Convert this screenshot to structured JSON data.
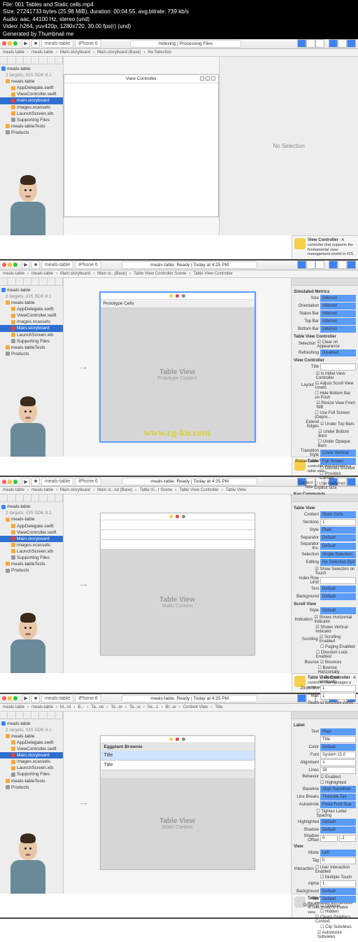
{
  "video_info": {
    "file": "File: 001 Tables and Static cells.mp4",
    "size": "Size: 27241733 bytes (25.98 MiB), duration: 00:04:55, avg.bitrate: 739 kb/s",
    "audio": "Audio: aac, 44100 Hz, stereo (und)",
    "video": "Video: h264, yuv420p, 1280x720, 30.00 fps(r) (und)",
    "gen": "Generated by Thumbnail me"
  },
  "watermark": "www.cg-ku.com",
  "nav": {
    "project": "meals-table",
    "targets": "2 targets, iOS SDK 8.1",
    "items": [
      "AppDelegate.swift",
      "ViewController.swift",
      "main.storyboard",
      "images.xcassets",
      "LaunchScreen.xib",
      "Supporting Files",
      "Main.storyboard",
      "meals-tableTests",
      "Products"
    ]
  },
  "status1": "Indexing | Processing Files",
  "status2": "meals-table: Ready | Today at 4:25 PM",
  "scheme": "meals-table",
  "device": "iPhone 6",
  "bc1": [
    "meals-table",
    "meals-table",
    "Main.storyboard",
    "Main.storyboard (Base)",
    "No Selection"
  ],
  "bc2": [
    "meals-table",
    "meals-table",
    "Main.storyboard",
    "Main st...(Base)",
    "Table View Controller Scene",
    "Table View Controller"
  ],
  "bc3": [
    "meals-table",
    "meals-table",
    "Main.storyboard",
    "Main st...nd (Base)",
    "Table Vi...r Scene",
    "Table View Controller",
    "Table View"
  ],
  "bc4": [
    "meals-table",
    "meals-table",
    "M...rd",
    "B...",
    "Ta...ne",
    "Ta...er",
    "Ta...w",
    "Se...1",
    "Br...ie",
    "Content View",
    "Title"
  ],
  "scene1": {
    "title": "View Controller"
  },
  "scene2": {
    "proto": "Prototype Cells",
    "tv": "Table View",
    "sub": "Prototype Content"
  },
  "scene3": {
    "tv": "Table View",
    "sub": "Static Content"
  },
  "scene4": {
    "header": "Eggplant Brownie",
    "cell1": "Title",
    "cell2": "Title",
    "tv": "Table View",
    "sub": "Static Content"
  },
  "insp1": "No Selection",
  "insp2": {
    "sim": "Simulated Metrics",
    "size": "Inferred",
    "orientation": "Inferred",
    "statusbar": "Inferred",
    "topbar": "Inferred",
    "bottombar": "Inferred",
    "tvc": "Table View Controller",
    "selection_chk": "Clear on Appearance",
    "refreshing": "Disabled",
    "vc": "View Controller",
    "title": "",
    "is_initial": "Is Initial View Controller",
    "layout1": "Adjust Scroll View Insets",
    "layout2": "Hide Bottom Bar on Push",
    "layout3": "Resize View From NIB",
    "layout4": "Use Full Screen (Depre...",
    "ee1": "Under Top Bars",
    "ee2": "Under Bottom Bars",
    "ee3": "Under Opaque Bars",
    "ee": "Extend Edges",
    "trans": "Cover Vertical",
    "pres": "Full Screen",
    "def": "Defines Context",
    "prov": "Provides Context",
    "content": "Use Preferred Explicit Size",
    "kc": "Key Commands",
    "obj": "Table View Controller",
    "objd": "A controller that manages a table view."
  },
  "insp3": {
    "tv": "Table View",
    "content": "Static Cells",
    "sections": "1",
    "style": "Plain",
    "separator": "Default",
    "sepins": "Default",
    "selection": "Single Selection",
    "editing": "No Selection During E...",
    "showsel": "Show Selection on Touch",
    "idx": "Index Row Limit",
    "text": "Default",
    "bg": "Default",
    "sv": "Scroll View",
    "svstyle": "Default",
    "ind1": "Shows Horizontal Indicator",
    "ind2": "Shows Vertical Indicator",
    "scroll": "Scrolling Enabled",
    "paging": "Paging Enabled",
    "dirlock": "Direction Lock Enabled",
    "bounces": "Bounces",
    "bh": "Bounce Horizontally",
    "bv": "Bounce Vertically",
    "zoom_min": "1",
    "zoom_max": "1",
    "bz": "Bounces Zoom",
    "touch": "Touch",
    "obj": "Table View Controller",
    "objd": "A controller that manages a table view."
  },
  "insp4": {
    "lbl": "Label",
    "text": "Plain",
    "textval": "Title",
    "color": "Default",
    "font": "System 15.0",
    "align": "Alignment",
    "lines": "38",
    "behav": "Behavior",
    "enabled": "Enabled",
    "highlighted": "Highlighted",
    "baseline": "Align Baselines",
    "linebreak": "Truncate Tail",
    "autoshrink": "Fixed Font Size",
    "tighten": "Tighten Letter Spacing",
    "hilite": "Default",
    "shadow": "Default",
    "shoff_h": "0",
    "shoff_v": "-1",
    "view": "View",
    "mode": "Left",
    "tag": "0",
    "inter": "User Interaction Enabled",
    "multi": "Multiple Touch",
    "alpha": "1",
    "background": "Default",
    "tint": "Default",
    "draw1": "Opaque",
    "draw2": "Hidden",
    "draw3": "Clears Graphics Context",
    "draw4": "Clip Subviews",
    "draw5": "Autoresize Subviews",
    "obj": "Table View Cell",
    "objd": "Defines the attributes and behavior of cells (rows) in a table view."
  }
}
